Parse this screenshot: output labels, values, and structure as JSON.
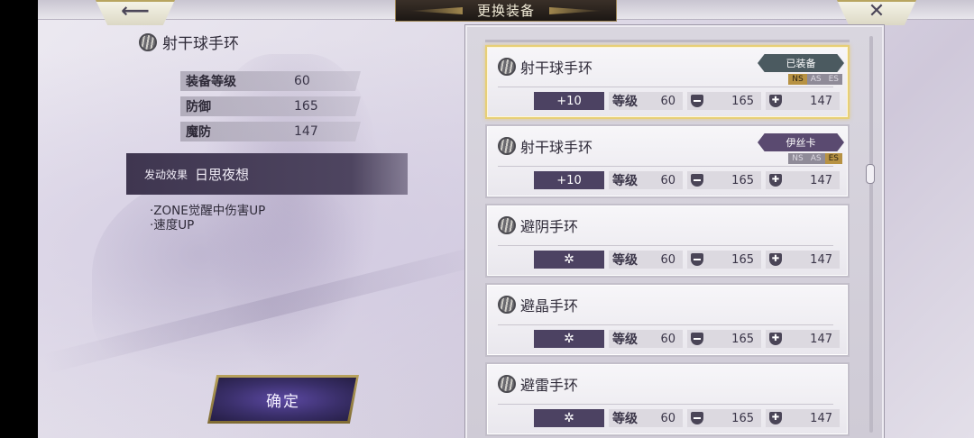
{
  "header": {
    "title": "更换装备",
    "back_icon": "arrow-left-icon",
    "close_icon": "close-icon"
  },
  "detail": {
    "item_name": "射干球手环",
    "stats": [
      {
        "label": "装备等级",
        "value": "60"
      },
      {
        "label": "防御",
        "value": "165"
      },
      {
        "label": "魔防",
        "value": "147"
      }
    ],
    "skill_tag": "发动效果",
    "skill_name": "日思夜想",
    "skill_desc_lines": [
      "·ZONE觉醒中伤害UP",
      "·速度UP"
    ],
    "confirm_label": "确定"
  },
  "list": {
    "level_label": "等级",
    "items": [
      {
        "name": "射干球手环",
        "enhance": "+10",
        "level": "60",
        "def": "165",
        "mdef": "147",
        "owner": "已装备",
        "slots": [
          "NS",
          "AS",
          "ES"
        ],
        "slot_states": [
          "on",
          "off",
          "off"
        ],
        "selected": true
      },
      {
        "name": "射干球手环",
        "enhance": "+10",
        "level": "60",
        "def": "165",
        "mdef": "147",
        "owner": "伊丝卡",
        "slots": [
          "NS",
          "AS",
          "ES"
        ],
        "slot_states": [
          "off",
          "off",
          "on"
        ],
        "selected": false
      },
      {
        "name": "避阴手环",
        "enhance": "✲",
        "level": "60",
        "def": "165",
        "mdef": "147",
        "owner": "",
        "slots": [],
        "slot_states": [],
        "selected": false
      },
      {
        "name": "避晶手环",
        "enhance": "✲",
        "level": "60",
        "def": "165",
        "mdef": "147",
        "owner": "",
        "slots": [],
        "slot_states": [],
        "selected": false
      },
      {
        "name": "避雷手环",
        "enhance": "✲",
        "level": "60",
        "def": "165",
        "mdef": "147",
        "owner": "",
        "slots": [],
        "slot_states": [],
        "selected": false
      }
    ]
  },
  "colors": {
    "accent_gold": "#e7cf77",
    "plate_dark": "#4c4262",
    "button_purple": "#3a2f6a"
  }
}
